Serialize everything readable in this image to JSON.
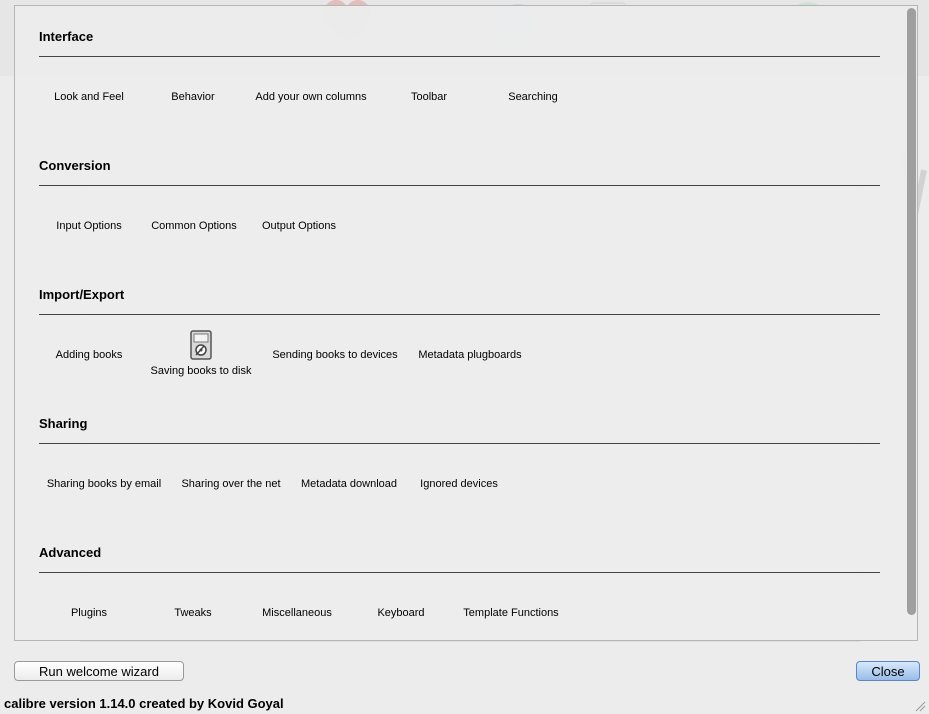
{
  "sections": [
    {
      "title": "Interface",
      "items": [
        "Look and Feel",
        "Behavior",
        "Add your own columns",
        "Toolbar",
        "Searching"
      ]
    },
    {
      "title": "Conversion",
      "items": [
        "Input Options",
        "Common Options",
        "Output Options"
      ]
    },
    {
      "title": "Import/Export",
      "items": [
        "Adding books",
        "Saving books to disk",
        "Sending books to devices",
        "Metadata plugboards"
      ]
    },
    {
      "title": "Sharing",
      "items": [
        "Sharing books by email",
        "Sharing over the net",
        "Metadata download",
        "Ignored devices"
      ]
    },
    {
      "title": "Advanced",
      "items": [
        "Plugins",
        "Tweaks",
        "Miscellaneous",
        "Keyboard",
        "Template Functions"
      ]
    }
  ],
  "buttons": {
    "wizard": "Run welcome wizard",
    "close": "Close"
  },
  "footer": {
    "version": "calibre version 1.14.0 created by Kovid Goyal"
  },
  "icons": {
    "saving_books": "disk-icon"
  },
  "colors": {
    "close_button": "#98bde9",
    "rule": "#444444"
  }
}
